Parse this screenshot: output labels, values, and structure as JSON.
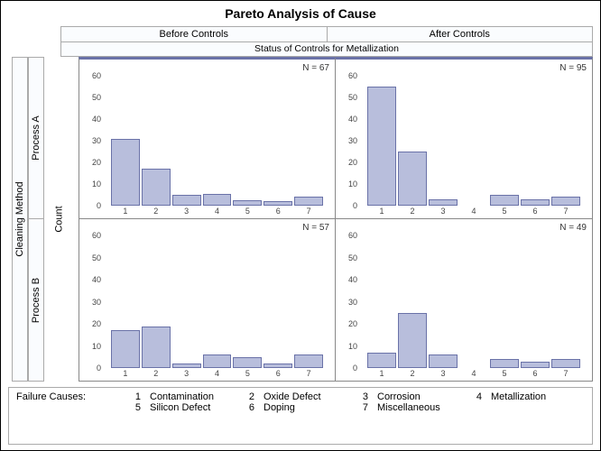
{
  "title": "Pareto Analysis of Cause",
  "subtitle": "Status of Controls for Metallization",
  "col_headers": [
    "Before Controls",
    "After Controls"
  ],
  "row_headers": [
    "Process A",
    "Process B"
  ],
  "row_outer_label": "Cleaning Method",
  "y_label": "Count",
  "legend_label": "Failure Causes:",
  "legend_items": [
    {
      "num": "1",
      "label": "Contamination"
    },
    {
      "num": "2",
      "label": "Oxide Defect"
    },
    {
      "num": "3",
      "label": "Corrosion"
    },
    {
      "num": "4",
      "label": "Metallization"
    },
    {
      "num": "5",
      "label": "Silicon Defect"
    },
    {
      "num": "6",
      "label": "Doping"
    },
    {
      "num": "7",
      "label": "Miscellaneous"
    }
  ],
  "chart_data": [
    {
      "row": "Process A",
      "col": "Before Controls",
      "type": "bar",
      "n_label": "N = 67",
      "ylim": [
        0,
        65
      ],
      "y_ticks": [
        0,
        10,
        20,
        30,
        40,
        50,
        60
      ],
      "categories": [
        "1",
        "2",
        "3",
        "4",
        "5",
        "6",
        "7"
      ],
      "values": [
        31,
        17,
        5,
        5.5,
        2.5,
        2,
        4
      ]
    },
    {
      "row": "Process A",
      "col": "After Controls",
      "type": "bar",
      "n_label": "N = 95",
      "ylim": [
        0,
        65
      ],
      "y_ticks": [
        0,
        10,
        20,
        30,
        40,
        50,
        60
      ],
      "categories": [
        "1",
        "2",
        "3",
        "4",
        "5",
        "6",
        "7"
      ],
      "values": [
        55,
        25,
        3,
        0,
        5,
        3,
        4
      ]
    },
    {
      "row": "Process B",
      "col": "Before Controls",
      "type": "bar",
      "n_label": "N = 57",
      "ylim": [
        0,
        65
      ],
      "y_ticks": [
        0,
        10,
        20,
        30,
        40,
        50,
        60
      ],
      "categories": [
        "1",
        "2",
        "3",
        "4",
        "5",
        "6",
        "7"
      ],
      "values": [
        17,
        19,
        2,
        6,
        5,
        2,
        6
      ]
    },
    {
      "row": "Process B",
      "col": "After Controls",
      "type": "bar",
      "n_label": "N = 49",
      "ylim": [
        0,
        65
      ],
      "y_ticks": [
        0,
        10,
        20,
        30,
        40,
        50,
        60
      ],
      "categories": [
        "1",
        "2",
        "3",
        "4",
        "5",
        "6",
        "7"
      ],
      "values": [
        7,
        25,
        6,
        0,
        4,
        3,
        4
      ]
    }
  ]
}
